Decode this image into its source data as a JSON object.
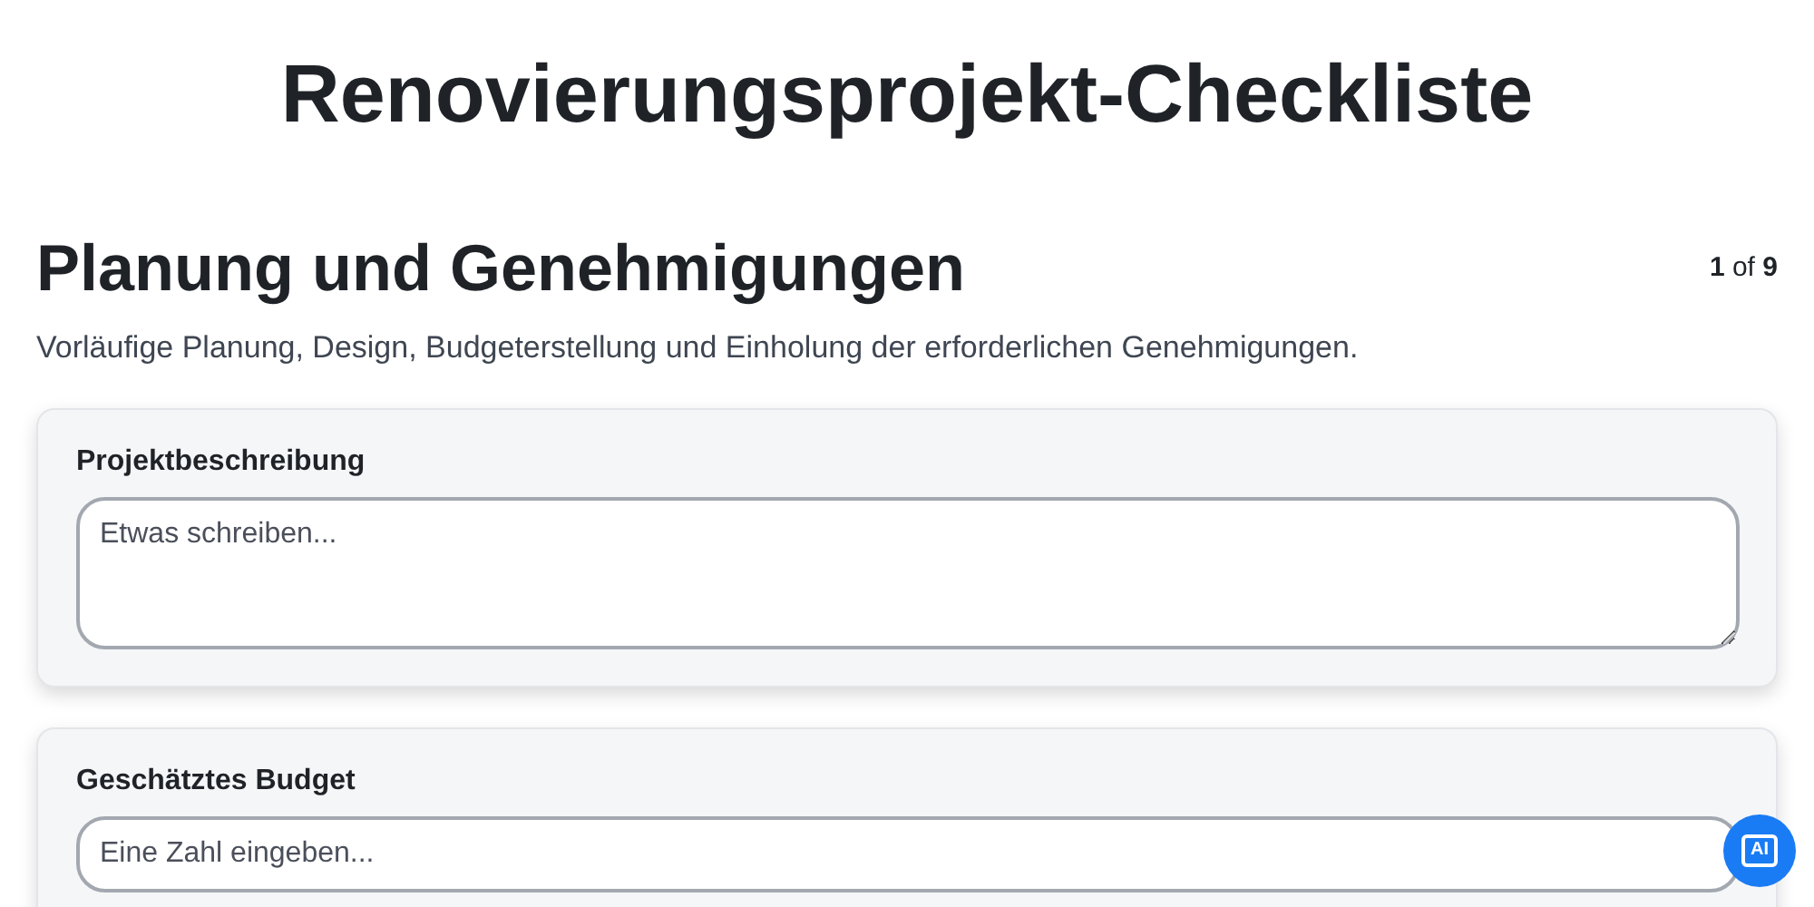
{
  "title": "Renovierungsprojekt-Checkliste",
  "section": {
    "heading": "Planung und Genehmigungen",
    "pager": "**1** of **9**",
    "description": "Vorläufige Planung, Design, Budgeterstellung und Einholung der erforderlichen Genehmigungen."
  },
  "fields": [
    {
      "kind": "textarea",
      "label": "Projektbeschreibung",
      "placeholder": "Etwas schreiben..."
    },
    {
      "kind": "number",
      "label": "Geschätztes Budget",
      "placeholder": "Eine Zahl eingeben..."
    }
  ],
  "ai_button": {
    "label": "AI"
  }
}
